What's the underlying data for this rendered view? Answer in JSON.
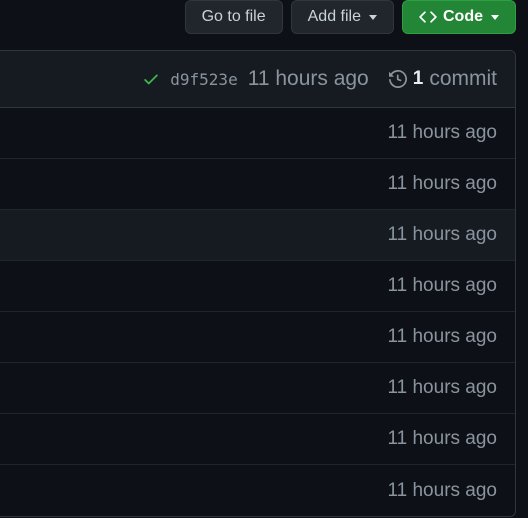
{
  "toolbar": {
    "go_to_file": "Go to file",
    "add_file": "Add file",
    "code": "Code"
  },
  "commit": {
    "sha": "d9f523e",
    "relative_time": "11 hours ago",
    "count": "1",
    "count_label": "commit"
  },
  "rows": [
    {
      "relative_time": "11 hours ago"
    },
    {
      "relative_time": "11 hours ago"
    },
    {
      "relative_time": "11 hours ago"
    },
    {
      "relative_time": "11 hours ago"
    },
    {
      "relative_time": "11 hours ago"
    },
    {
      "relative_time": "11 hours ago"
    },
    {
      "relative_time": "11 hours ago"
    },
    {
      "relative_time": "11 hours ago"
    }
  ]
}
